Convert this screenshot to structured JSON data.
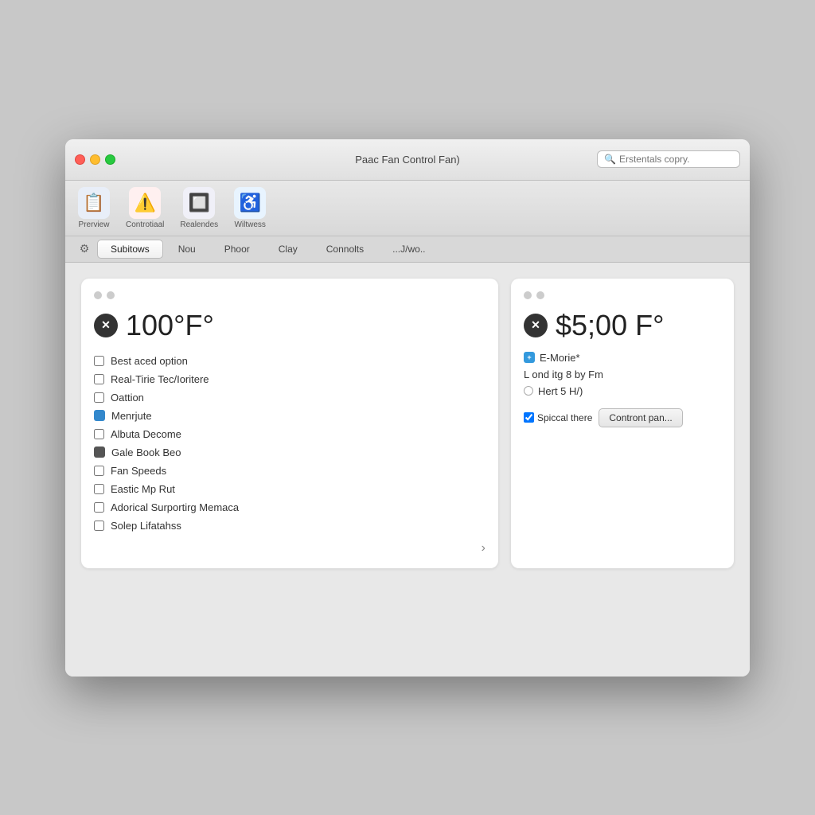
{
  "window": {
    "title": "Paac Fan Control Fan)"
  },
  "search": {
    "placeholder": "Erstentals copry."
  },
  "toolbar": {
    "items": [
      {
        "id": "preview",
        "label": "Prerview",
        "icon": "📋"
      },
      {
        "id": "control",
        "label": "Controtiaal",
        "icon": "⚠️"
      },
      {
        "id": "real",
        "label": "Realendes",
        "icon": "🔲"
      },
      {
        "id": "wit",
        "label": "Wiltwess",
        "icon": "♿"
      }
    ]
  },
  "tabs": {
    "items": [
      {
        "id": "subitows",
        "label": "Subitows",
        "active": true
      },
      {
        "id": "nou",
        "label": "Nou"
      },
      {
        "id": "phoor",
        "label": "Phoor"
      },
      {
        "id": "clay",
        "label": "Clay"
      },
      {
        "id": "connolts",
        "label": "Connolts"
      },
      {
        "id": "jwo",
        "label": "...J/wo.."
      }
    ]
  },
  "left_panel": {
    "temperature": "100°F°",
    "checklist": [
      {
        "id": "best",
        "label": "Best aced option",
        "type": "checkbox",
        "checked": false
      },
      {
        "id": "real",
        "label": "Real-Tirie Tec/Ioritere",
        "type": "checkbox",
        "checked": false
      },
      {
        "id": "oattion",
        "label": "Oattion",
        "type": "checkbox",
        "checked": false
      },
      {
        "id": "menrjute",
        "label": "Menrjute",
        "type": "blue-square",
        "checked": true
      },
      {
        "id": "albuta",
        "label": "Albuta Decome",
        "type": "checkbox",
        "checked": false
      },
      {
        "id": "gale",
        "label": "Gale Book Beo",
        "type": "globe",
        "checked": true
      },
      {
        "id": "fan",
        "label": "Fan Speeds",
        "type": "checkbox",
        "checked": false
      },
      {
        "id": "eastic",
        "label": "Eastic Mp Rut",
        "type": "checkbox",
        "checked": false
      },
      {
        "id": "adorical",
        "label": "Adorical Surportirg Memaca",
        "type": "checkbox",
        "checked": false
      },
      {
        "id": "solep",
        "label": "Solep Lifatahss",
        "type": "checkbox",
        "checked": false
      }
    ]
  },
  "right_panel": {
    "temperature": "$5;00 F°",
    "e_morie": "E-Morie*",
    "l_ond": "L ond itg 8 by Fm",
    "hert": "Hert 5 H/)",
    "checkbox_label": "Spiccal there",
    "button_label": "Contront pan..."
  }
}
